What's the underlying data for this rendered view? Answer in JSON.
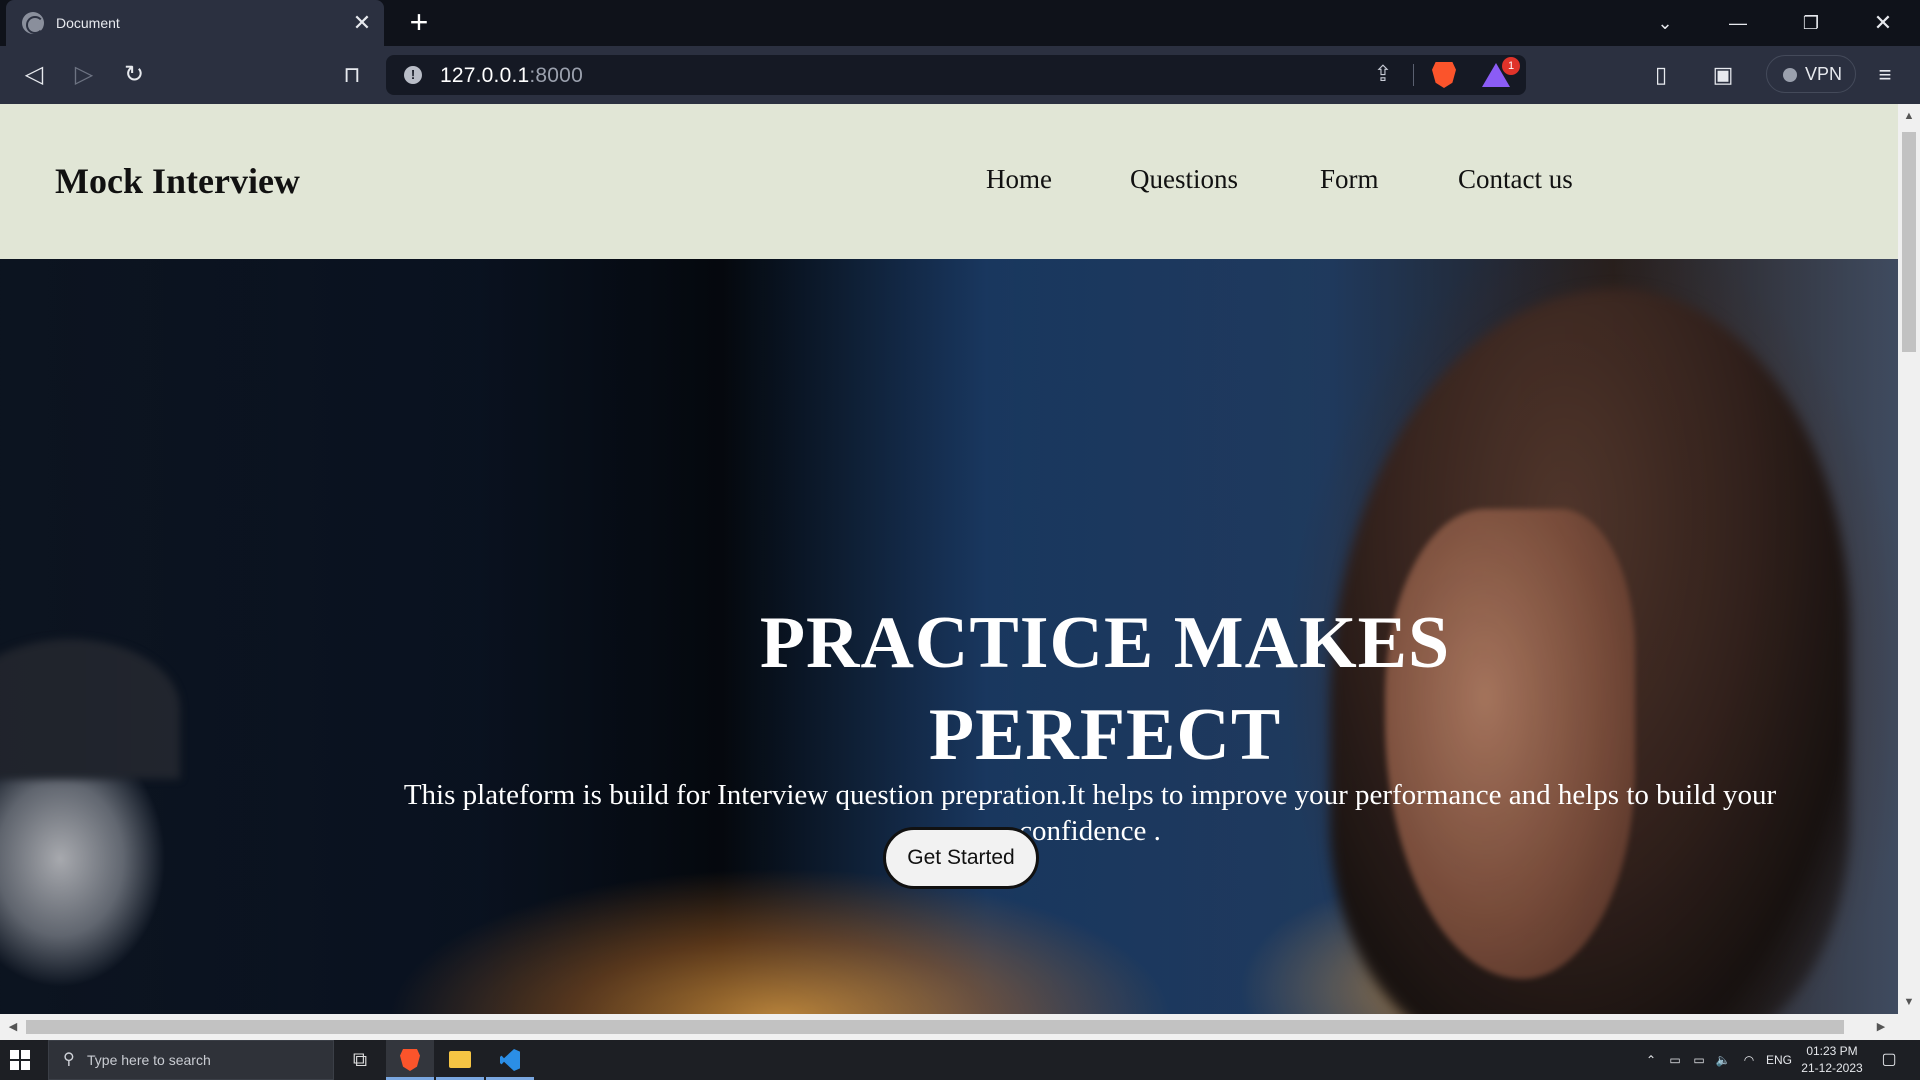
{
  "browser": {
    "tab": {
      "title": "Document"
    },
    "address": {
      "host": "127.0.0.1",
      "port": ":8000"
    },
    "rewards_badge": "1",
    "vpn_label": "VPN"
  },
  "site": {
    "logo": "Mock Interview",
    "nav": [
      "Home",
      "Questions",
      "Form",
      "Contact us"
    ],
    "hero": {
      "title": "PRACTICE MAKES PERFECT",
      "subtitle": "This plateform is build for Interview question prepration.It helps to improve your performance and helps to build your confidence .",
      "cta": "Get Started"
    }
  },
  "taskbar": {
    "search_placeholder": "Type here to search",
    "language": "ENG",
    "time": "01:23 PM",
    "date": "21-12-2023"
  },
  "icons": {
    "tab_favicon": "globe-icon",
    "tab_close": "close-icon",
    "new_tab": "plus-icon",
    "back": "back-icon",
    "forward": "forward-icon",
    "reload": "reload-icon",
    "bookmark": "bookmark-icon",
    "site_info": "info-icon",
    "share": "share-icon",
    "shields": "brave-shields-icon",
    "rewards": "brave-rewards-icon",
    "sidebar": "sidebar-icon",
    "wallet": "wallet-icon",
    "menu": "hamburger-menu-icon"
  }
}
